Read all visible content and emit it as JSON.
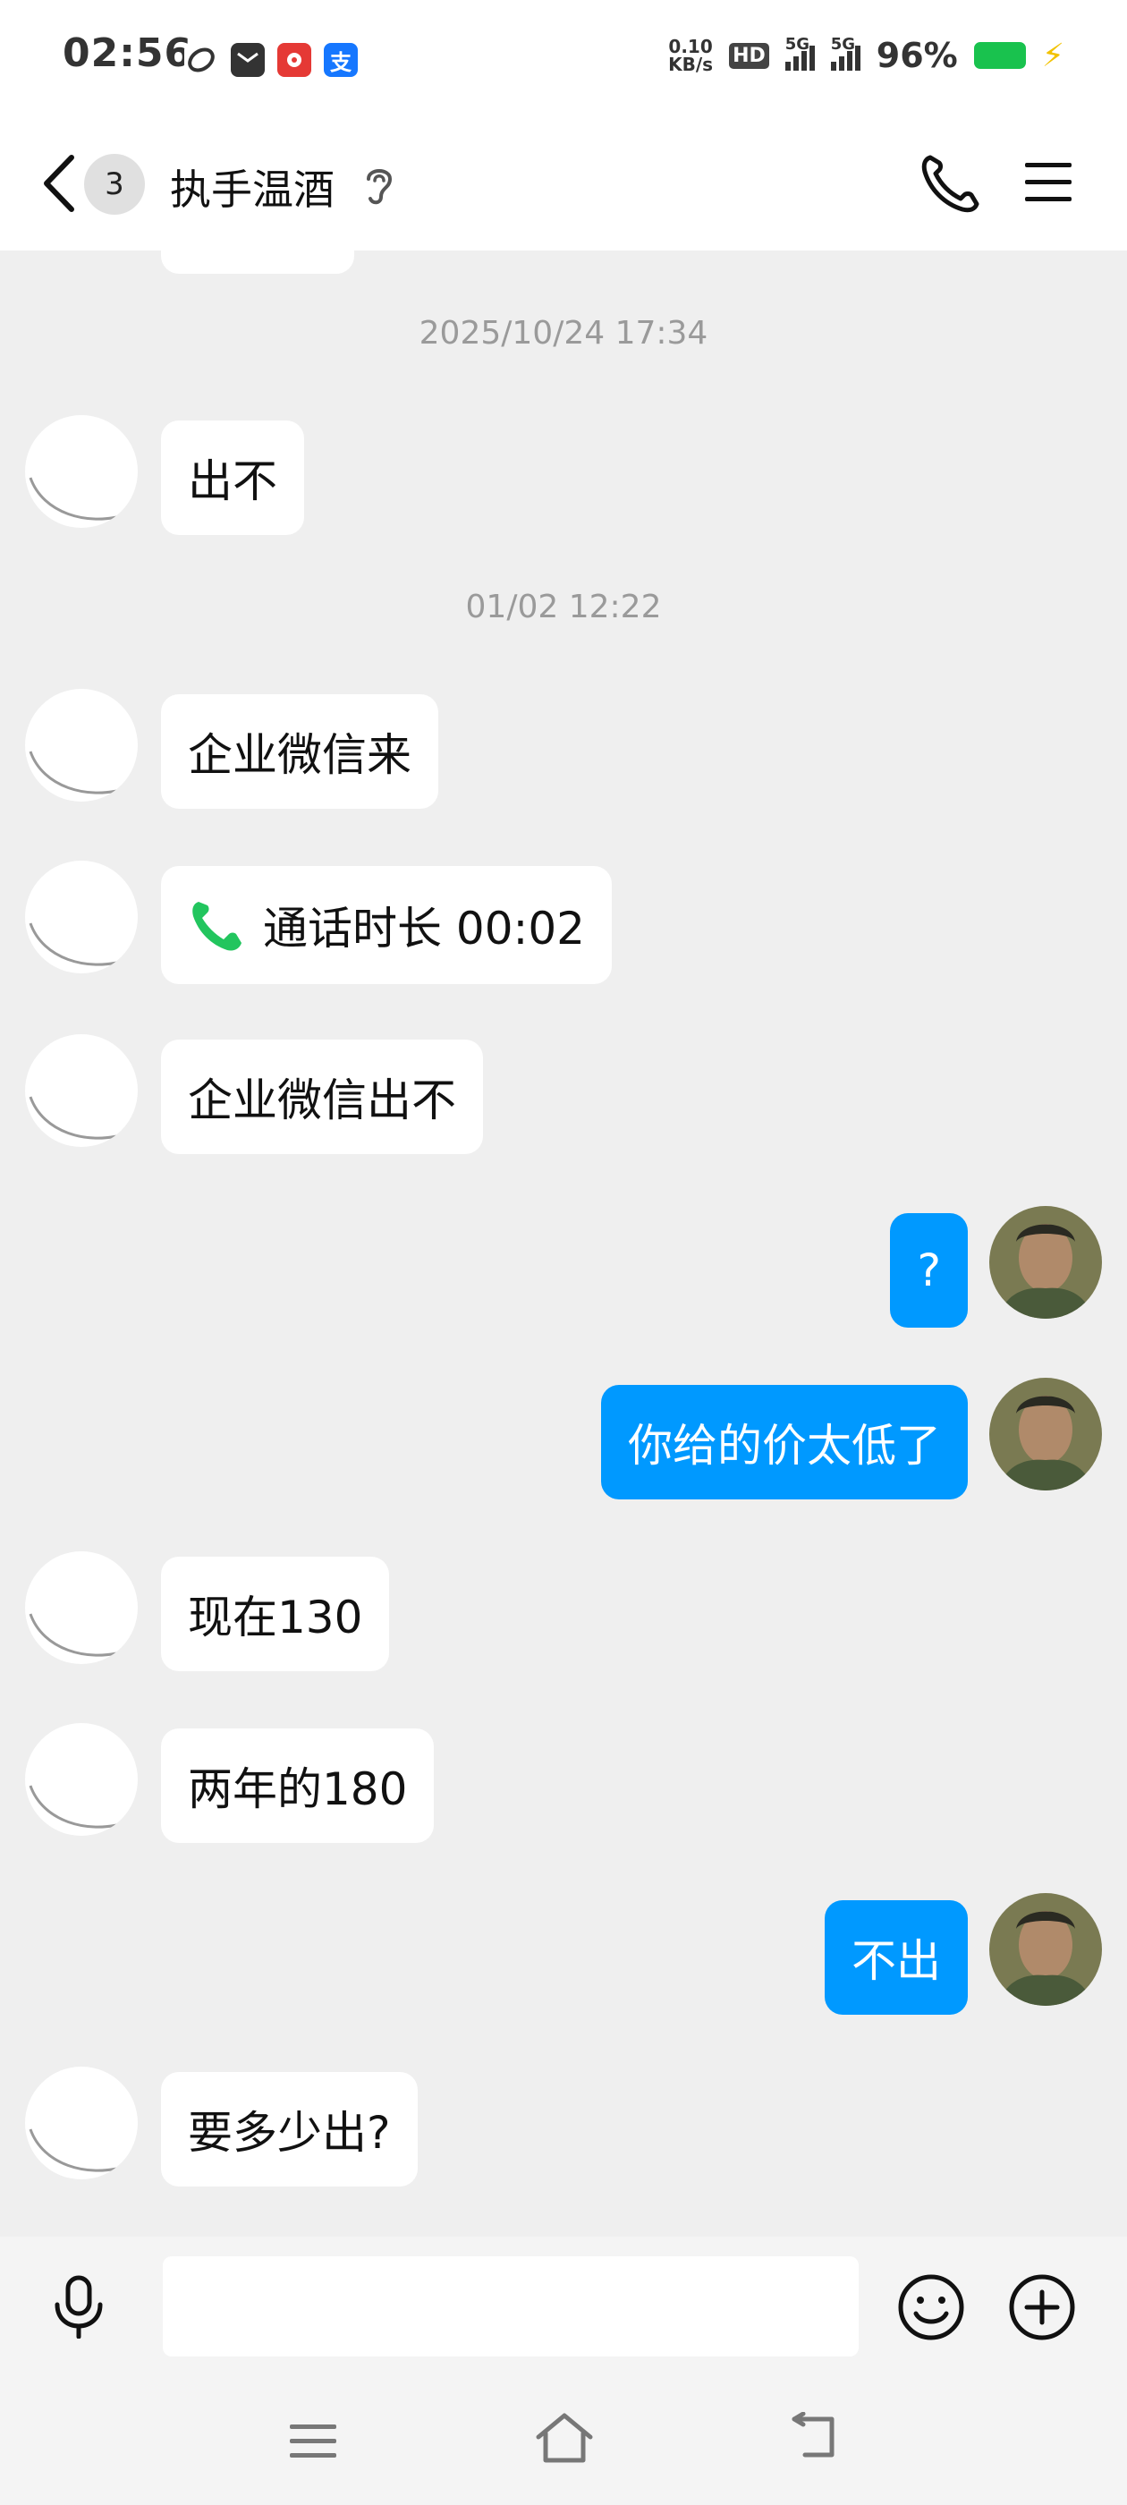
{
  "status_bar": {
    "time": "02:56",
    "net_speed_value": "0.10",
    "net_speed_unit": "KB/s",
    "hd_label": "HD",
    "signal1_label": "5G",
    "signal2_label": "5G",
    "battery_percent": "96%",
    "battery_level": 0.96,
    "app_icon_2_label": "支"
  },
  "header": {
    "unread_count": "3",
    "title": "执手温酒"
  },
  "messages": [
    {
      "type": "timestamp",
      "text": "2025/10/24 17:34"
    },
    {
      "type": "received",
      "text": "出不"
    },
    {
      "type": "timestamp",
      "text": "01/02 12:22"
    },
    {
      "type": "received",
      "text": "企业微信来"
    },
    {
      "type": "received_call",
      "text": "通话时长 00:02"
    },
    {
      "type": "received",
      "text": "企业微信出不"
    },
    {
      "type": "sent",
      "text": "?"
    },
    {
      "type": "sent",
      "text": "你给的价太低了"
    },
    {
      "type": "received",
      "text": "现在130"
    },
    {
      "type": "received",
      "text": "两年的180"
    },
    {
      "type": "sent",
      "text": "不出"
    },
    {
      "type": "received",
      "text": "要多少出?"
    }
  ],
  "input": {
    "value": "",
    "placeholder": ""
  },
  "colors": {
    "sent_bubble": "#0099ff",
    "received_bubble": "#ffffff",
    "background": "#efefef",
    "call_icon": "#22c55e",
    "battery": "#19c24e"
  },
  "icons": {
    "back": "chevron-left-icon",
    "ear": "ear-icon",
    "phone": "phone-icon",
    "menu": "hamburger-menu-icon",
    "mic": "microphone-icon",
    "emoji": "smiley-icon",
    "plus": "plus-circle-icon",
    "call": "phone-call-icon"
  }
}
